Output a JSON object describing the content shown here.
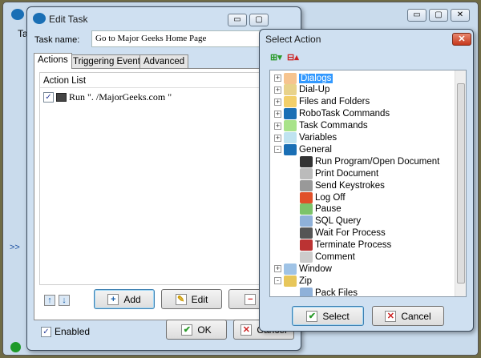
{
  "main_window": {
    "tab_partial": "Ta",
    "link_partial": ">> "
  },
  "edit_task": {
    "title": "Edit Task",
    "task_name_label": "Task name:",
    "task_name_value": "Go to  Major Geeks Home Page",
    "tabs": [
      {
        "label": "Actions",
        "active": true
      },
      {
        "label": "Triggering Events"
      },
      {
        "label": "Advanced"
      }
    ],
    "action_list_header": "Action List",
    "actions": [
      {
        "checked": true,
        "label": "Run \". /MajorGeeks.com  \""
      }
    ],
    "buttons": {
      "add": "Add",
      "edit": "Edit",
      "remove": "Re",
      "ok": "OK",
      "cancel": "Cancel"
    },
    "enabled_label": "Enabled",
    "enabled": true
  },
  "select_action": {
    "title": "Select Action",
    "tree": [
      {
        "label": "Dialogs",
        "level": 0,
        "expand": "+",
        "selected": true,
        "icon": "dialog-icon",
        "color": "#f6c48f"
      },
      {
        "label": "Dial-Up",
        "level": 0,
        "expand": "+",
        "icon": "phone-icon",
        "color": "#e8d28a"
      },
      {
        "label": "Files and Folders",
        "level": 0,
        "expand": "+",
        "icon": "folder-icon",
        "color": "#f2cf6a"
      },
      {
        "label": "RoboTask Commands",
        "level": 0,
        "expand": "+",
        "icon": "robotask-icon",
        "color": "#1a6fb5"
      },
      {
        "label": "Task Commands",
        "level": 0,
        "expand": "+",
        "icon": "task-icon",
        "color": "#a8e38a"
      },
      {
        "label": "Variables",
        "level": 0,
        "expand": "+",
        "icon": "variables-icon",
        "color": "#bfe3f0"
      },
      {
        "label": "General",
        "level": 0,
        "expand": "-",
        "icon": "robotask-icon",
        "color": "#1a6fb5"
      },
      {
        "label": "Run Program/Open Document",
        "level": 1,
        "icon": "console-icon",
        "color": "#333"
      },
      {
        "label": "Print Document",
        "level": 1,
        "icon": "printer-icon",
        "color": "#bbb"
      },
      {
        "label": "Send Keystrokes",
        "level": 1,
        "icon": "keyboard-icon",
        "color": "#999"
      },
      {
        "label": "Log Off",
        "level": 1,
        "icon": "logoff-icon",
        "color": "#e0502a"
      },
      {
        "label": "Pause",
        "level": 1,
        "icon": "pause-icon",
        "color": "#7cc36a"
      },
      {
        "label": "SQL Query",
        "level": 1,
        "icon": "sql-icon",
        "color": "#8fb1d9"
      },
      {
        "label": "Wait For Process",
        "level": 1,
        "icon": "wait-process-icon",
        "color": "#555"
      },
      {
        "label": "Terminate Process",
        "level": 1,
        "icon": "terminate-process-icon",
        "color": "#b33"
      },
      {
        "label": "Comment",
        "level": 1,
        "icon": "comment-icon",
        "color": "#ccc"
      },
      {
        "label": "Window",
        "level": 0,
        "expand": "+",
        "icon": "window-icon",
        "color": "#9fc3e6"
      },
      {
        "label": "Zip",
        "level": 0,
        "expand": "-",
        "icon": "zip-icon",
        "color": "#e7c65a"
      },
      {
        "label": "Pack Files",
        "level": 1,
        "icon": "pack-files-icon",
        "color": "#8fb1d9"
      }
    ],
    "buttons": {
      "select": "Select",
      "cancel": "Cancel"
    }
  }
}
